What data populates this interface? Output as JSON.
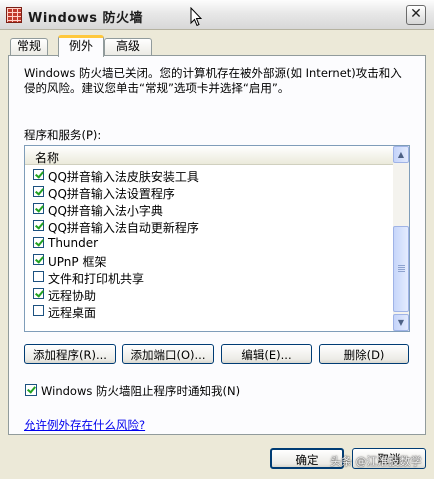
{
  "window": {
    "title": "Windows 防火墙",
    "close_glyph": "✕"
  },
  "tabs": [
    {
      "label": "常规",
      "active": false
    },
    {
      "label": "例外",
      "active": true
    },
    {
      "label": "高级",
      "active": false
    }
  ],
  "notice": "Windows 防火墙已关闭。您的计算机存在被外部源(如 Internet)攻击和入侵的风险。建议您单击“常规”选项卡并选择“启用”。",
  "programs_label": "程序和服务(P):",
  "list": {
    "column_header": "名称",
    "items": [
      {
        "label": "QQ拼音输入法皮肤安装工具",
        "checked": true
      },
      {
        "label": "QQ拼音输入法设置程序",
        "checked": true
      },
      {
        "label": "QQ拼音输入法小字典",
        "checked": true
      },
      {
        "label": "QQ拼音输入法自动更新程序",
        "checked": true
      },
      {
        "label": "Thunder",
        "checked": true
      },
      {
        "label": "UPnP 框架",
        "checked": true
      },
      {
        "label": "文件和打印机共享",
        "checked": false
      },
      {
        "label": "远程协助",
        "checked": true
      },
      {
        "label": "远程桌面",
        "checked": false
      }
    ]
  },
  "actions": {
    "add_program": "添加程序(R)...",
    "add_port": "添加端口(O)...",
    "edit": "编辑(E)...",
    "delete": "删除(D)"
  },
  "notify": {
    "label": "Windows 防火墙阻止程序时通知我(N)",
    "checked": true
  },
  "risk_link": "允许例外存在什么风险?",
  "footer": {
    "ok": "确定",
    "cancel": "取消"
  },
  "watermark": "头条 @江淮技数学"
}
